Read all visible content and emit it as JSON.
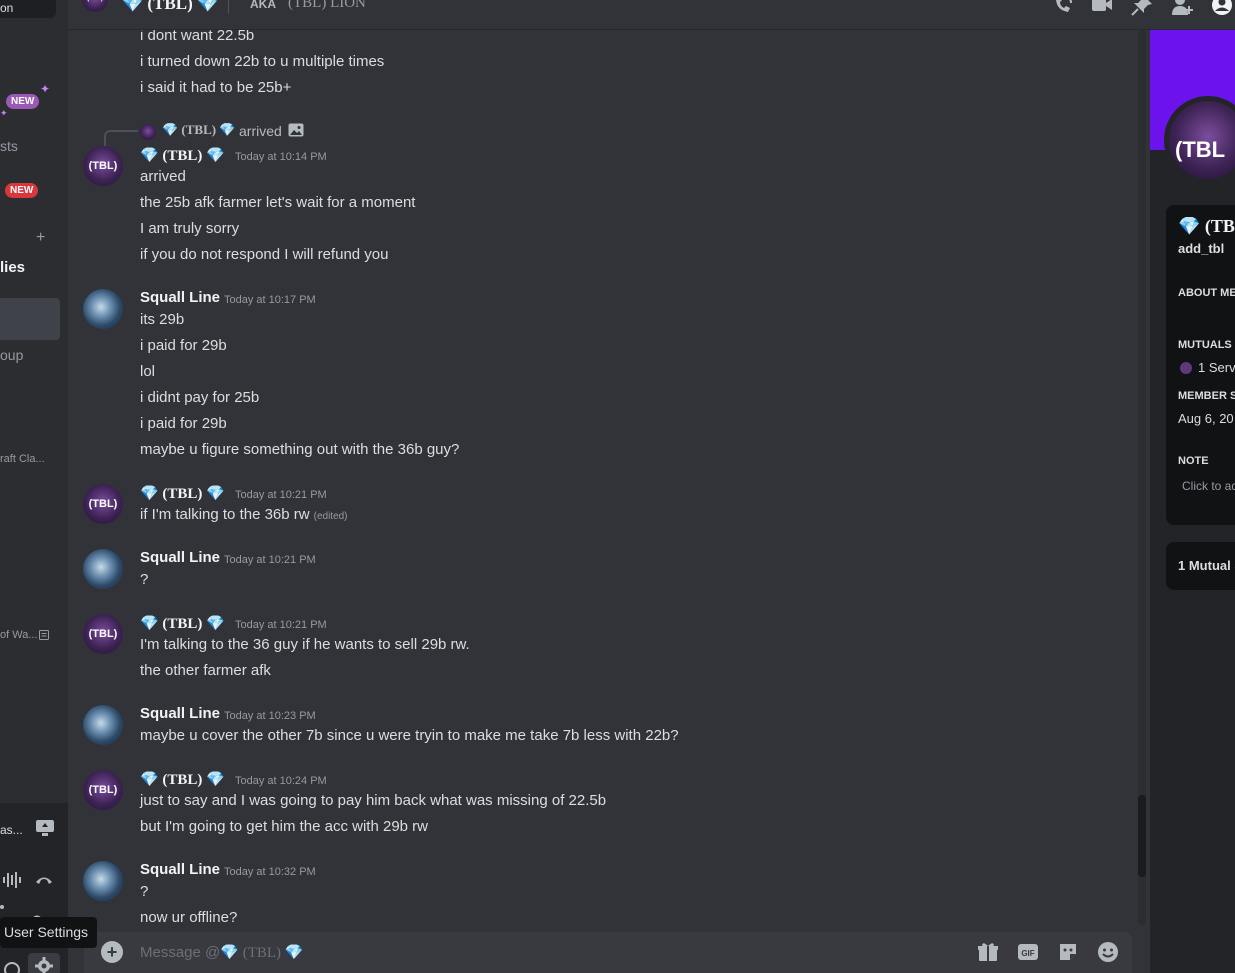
{
  "sidebar": {
    "top_box_label": "on",
    "new_badge_1": "NEW",
    "item_1": "sts",
    "new_badge_2": "NEW",
    "plus": "+",
    "item_bold": "lies",
    "item_2": "oup",
    "item_3": "raft Cla...",
    "item_4": "of Wa...",
    "bottom_label": "as..."
  },
  "tooltip": "User Settings",
  "header": {
    "name": "💎 (TBL) 💎",
    "aka": "AKA",
    "alias": "(TBL) LION"
  },
  "reply": {
    "author": "💎 (TBL) 💎",
    "text": "arrived"
  },
  "messages": {
    "pre": [
      "i dont want 22.5b",
      "i turned down 22b to u multiple times",
      "i said it had to be 25b+"
    ],
    "g1": {
      "author": "💎 (TBL) 💎",
      "time": "Today at 10:14 PM",
      "lines": [
        "arrived",
        "the 25b afk farmer let's wait for a moment",
        "I am truly sorry",
        "if you do not respond I will refund you"
      ]
    },
    "g2": {
      "author": "Squall Line",
      "time": "Today at 10:17 PM",
      "lines": [
        "its 29b",
        "i paid for 29b",
        "lol",
        "i didnt pay for 25b",
        "i paid for 29b",
        "maybe u figure something out with the 36b guy?"
      ]
    },
    "g3": {
      "author": "💎 (TBL) 💎",
      "time": "Today at 10:21 PM",
      "lines": [
        "if I'm talking to the 36b rw"
      ],
      "edited": "(edited)"
    },
    "g4": {
      "author": "Squall Line",
      "time": "Today at 10:21 PM",
      "lines": [
        "?"
      ]
    },
    "g5": {
      "author": "💎 (TBL) 💎",
      "time": "Today at 10:21 PM",
      "lines": [
        "I'm talking to the 36 guy if he wants to sell 29b rw.",
        "the other farmer  afk"
      ]
    },
    "g6": {
      "author": "Squall Line",
      "time": "Today at 10:23 PM",
      "lines": [
        "maybe u cover the other 7b since u were tryin to make me take 7b less with 22b?"
      ]
    },
    "g7": {
      "author": "💎 (TBL) 💎",
      "time": "Today at 10:24 PM",
      "lines": [
        "just to say and I was going to pay him back what was missing of 22.5b",
        "but I'm going to get him the acc with 29b rw"
      ]
    },
    "g8": {
      "author": "Squall Line",
      "time": "Today at 10:32 PM",
      "lines": [
        "?",
        "now ur offline?"
      ]
    }
  },
  "avatar_text": "(TBL)",
  "composer": {
    "prefix": "Message @",
    "target": "💎 (TBL) 💎"
  },
  "profile": {
    "avatar_text": "(TBL",
    "name": "💎 (TB",
    "username": "add_tbl",
    "about_head": "ABOUT ME",
    "mutuals_head": "MUTUALS",
    "mutual_server": "1 Serve",
    "member_since_head": "MEMBER S",
    "member_since": "Aug 6, 20",
    "note_head": "NOTE",
    "note_placeholder": "Click to ad",
    "mutual_servers_btn": "1 Mutual S"
  },
  "colors": {
    "background": "#313338",
    "sidebar": "#2b2d31",
    "banner": "#6c12ec",
    "gem": "#5bc0f8"
  }
}
